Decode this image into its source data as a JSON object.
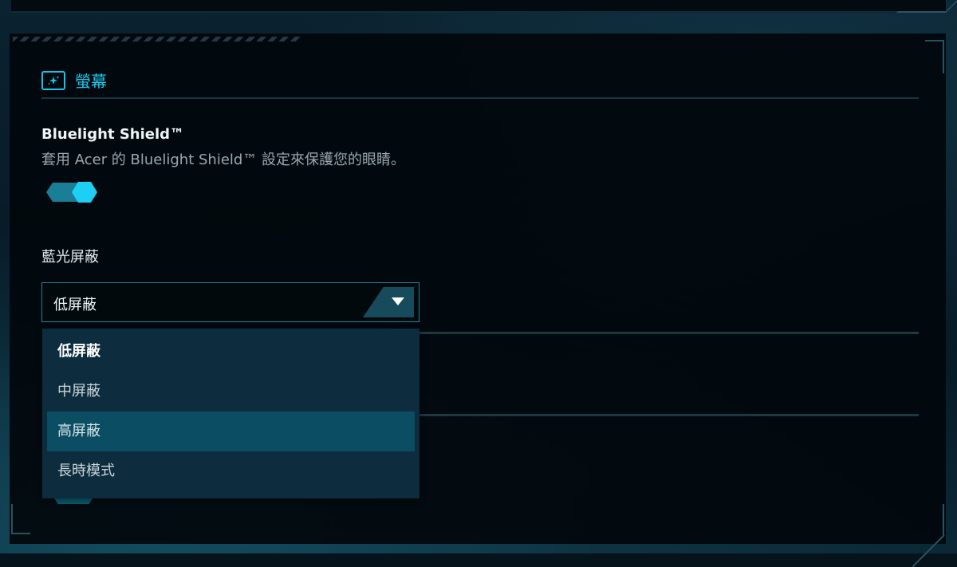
{
  "section": {
    "title": "螢幕",
    "icon": "monitor-sparkle-icon"
  },
  "bluelight": {
    "title": "Bluelight Shield™",
    "description": "套用 Acer 的 Bluelight Shield™ 設定來保護您的眼睛。",
    "enabled": true
  },
  "filter": {
    "label": "藍光屏蔽",
    "selected": "低屏蔽",
    "options": [
      {
        "label": "低屏蔽",
        "state": "selected"
      },
      {
        "label": "中屏蔽",
        "state": "normal"
      },
      {
        "label": "高屏蔽",
        "state": "hover"
      },
      {
        "label": "長時模式",
        "state": "normal"
      }
    ]
  },
  "colors": {
    "accent": "#1ec8ec",
    "toggle_track": "#1a7f96",
    "dropdown_bg": "#0d2d3e",
    "hover_bg": "#0b4d63"
  }
}
